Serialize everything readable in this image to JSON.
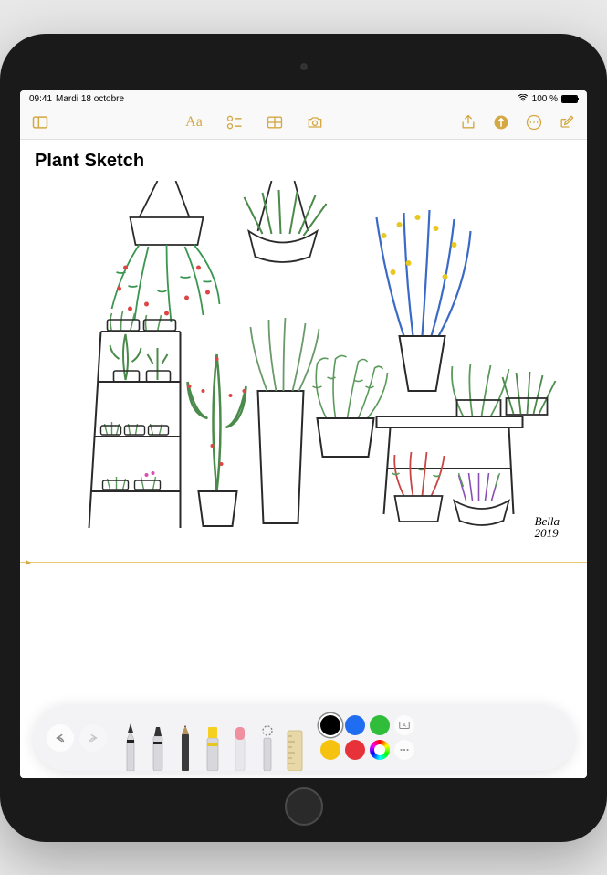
{
  "status": {
    "time": "09:41",
    "date": "Mardi 18 octobre",
    "battery": "100 %"
  },
  "toolbar": {
    "sidebar": "sidebar",
    "format": "Aa",
    "checklist": "checklist",
    "table": "table",
    "camera": "camera",
    "share": "share",
    "markup_circle": "markup",
    "more": "more",
    "compose": "compose"
  },
  "note": {
    "title": "Plant Sketch",
    "signature_name": "Bella",
    "signature_year": "2019"
  },
  "drawing_toolbar": {
    "undo": "undo",
    "redo": "redo",
    "tools": [
      "pen",
      "marker",
      "pencil",
      "highlighter",
      "eraser",
      "lasso",
      "ruler"
    ],
    "colors": {
      "black": "#000000",
      "blue": "#1f6df0",
      "green": "#2fbd3a",
      "yellow": "#f5c20f",
      "red": "#e63238",
      "selected": "black"
    },
    "text_tool": "text",
    "more": "more"
  },
  "accent": "#d4a843"
}
